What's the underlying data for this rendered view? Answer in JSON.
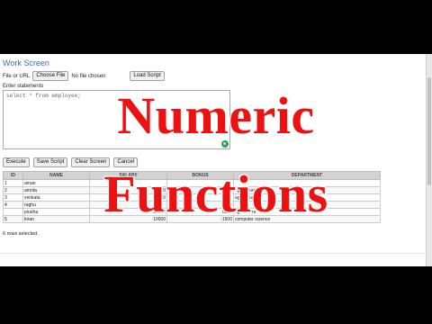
{
  "app": {
    "heading": "Work Screen"
  },
  "file": {
    "label": "File or URL",
    "choose_label": "Choose File",
    "status": "No file chosen",
    "load_label": "Load Script"
  },
  "editor": {
    "label": "Enter statements",
    "content": "select * from employee;"
  },
  "actions": {
    "execute": "Execute",
    "save": "Save Script",
    "clear": "Clear Screen",
    "cancel": "Cancel"
  },
  "results": {
    "columns": [
      "ID",
      "NAME",
      "SALARY",
      "BONUS",
      "DEPARTMENT"
    ],
    "rows": [
      [
        "1",
        "aman",
        "",
        "",
        ""
      ],
      [
        "2",
        "amrita",
        "0",
        "1500",
        "agriculture"
      ],
      [
        "3",
        "venkata",
        "0",
        "",
        "agriculture"
      ],
      [
        "4",
        "raghu",
        "",
        "10",
        ""
      ],
      [
        "",
        "piratha",
        "90000",
        "5000",
        "agriculture"
      ],
      [
        "5",
        "kiran",
        "10000",
        "-1500",
        "computer science"
      ]
    ],
    "status": "6 rows selected."
  },
  "overlay": {
    "line1": "Numeric",
    "line2": "Functions",
    "color": "#ee1111"
  }
}
